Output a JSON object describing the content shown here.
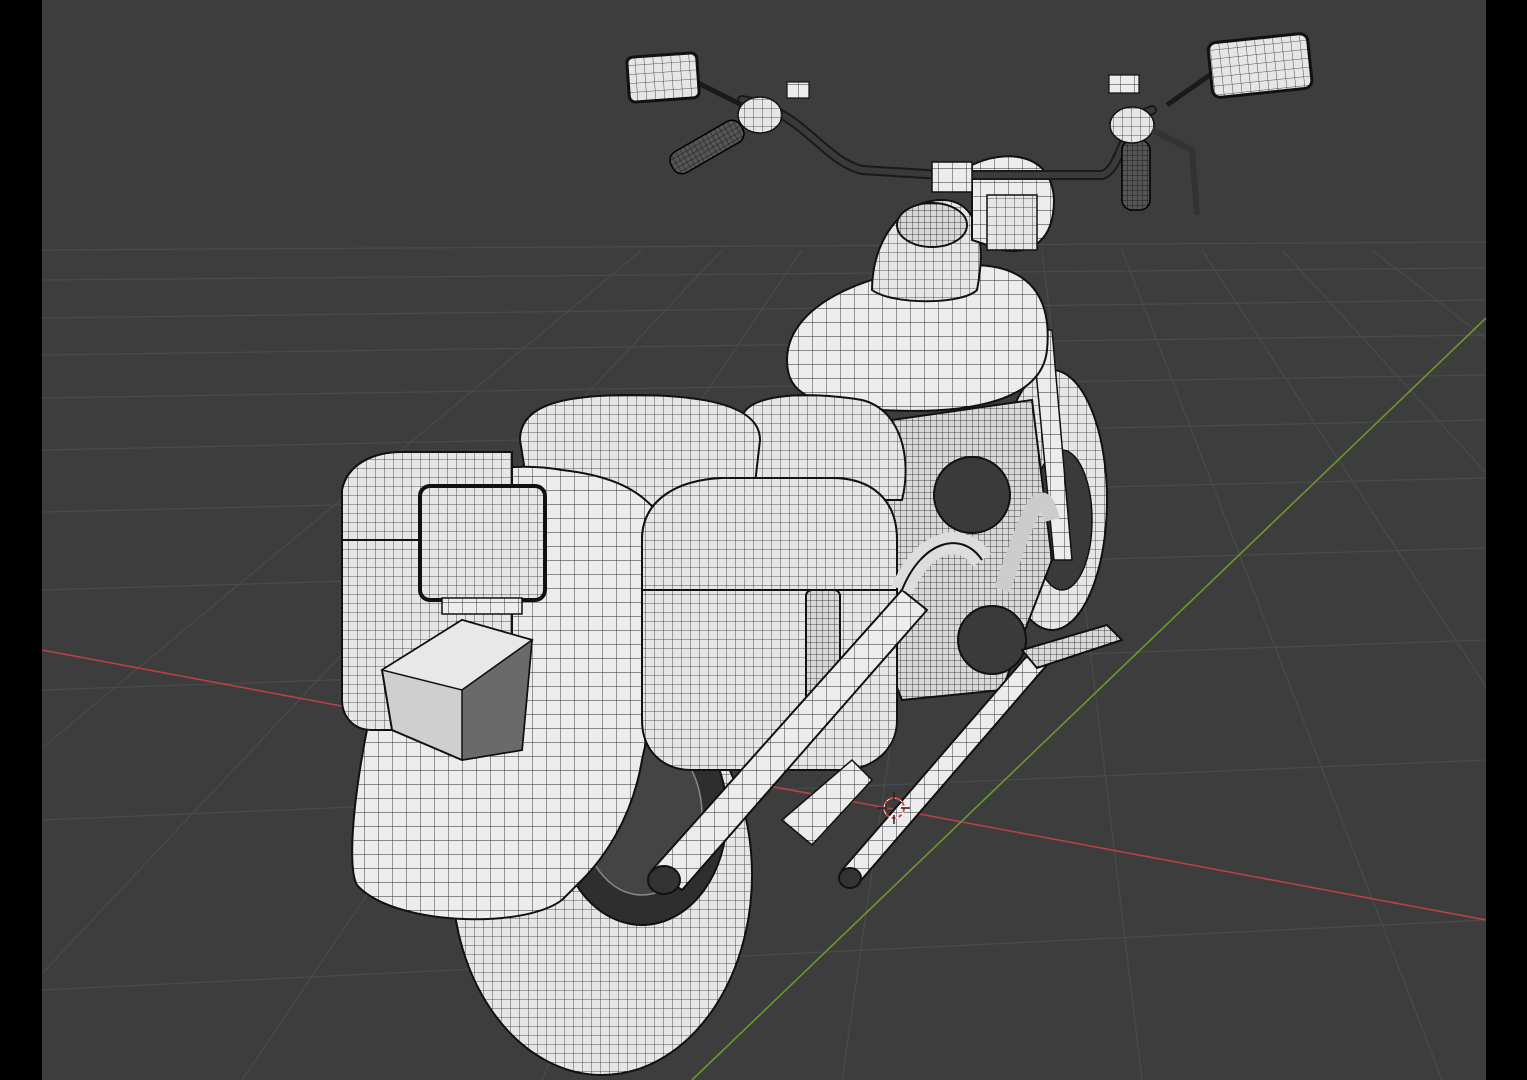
{
  "viewport": {
    "mode": "3d-viewport",
    "shading": "solid-wireframe-overlay",
    "background_color": "#3d3d3d",
    "grid_color": "#4a4a4a",
    "axis_x_color": "#b8404a",
    "axis_y_color": "#6a9a2a",
    "model_fill_color": "#eaeaea",
    "model_wire_color": "#1a1a1a",
    "cursor_color": "#e04040"
  },
  "scene": {
    "object": "motorcycle-mesh",
    "parts": [
      "rear-fender",
      "license-plate",
      "tail-light",
      "seat",
      "saddlebag-left",
      "saddlebag-right",
      "fuel-tank",
      "handlebar",
      "mirror-left",
      "mirror-right",
      "exhaust-upper",
      "exhaust-lower",
      "footpeg",
      "engine",
      "rear-wheel",
      "front-wheel"
    ]
  }
}
